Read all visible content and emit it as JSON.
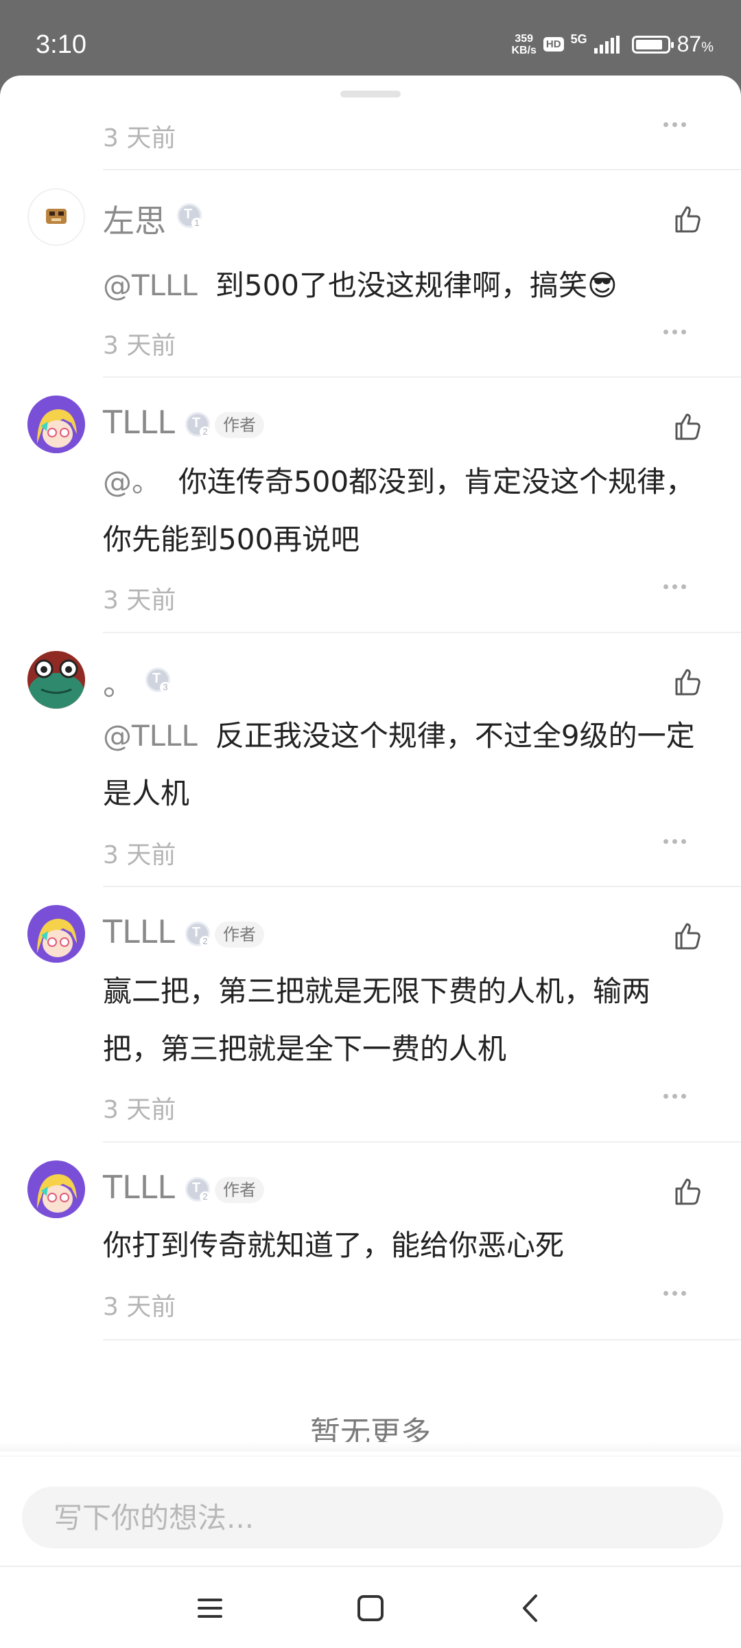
{
  "status_bar": {
    "time": "3:10",
    "net_speed_value": "359",
    "net_speed_unit": "KB/s",
    "hd": "HD",
    "network": "5G",
    "battery_level": 0.87,
    "battery_pct": "87",
    "battery_unit": "%"
  },
  "comments": [
    {
      "time": "3 天前"
    },
    {
      "user": "左思",
      "level": "1",
      "mention": "@TLLL",
      "text": "到500了也没这规律啊，搞笑😎",
      "time": "3 天前"
    },
    {
      "user": "TLLL",
      "level": "2",
      "author_tag": "作者",
      "mention": "@。",
      "text": "你连传奇500都没到，肯定没这个规律，你先能到500再说吧",
      "time": "3 天前"
    },
    {
      "user": "。",
      "level": "3",
      "mention": "@TLLL",
      "text": "反正我没这个规律，不过全9级的一定是人机",
      "time": "3 天前"
    },
    {
      "user": "TLLL",
      "level": "2",
      "author_tag": "作者",
      "text": "赢二把，第三把就是无限下费的人机，输两把，第三把就是全下一费的人机",
      "time": "3 天前"
    },
    {
      "user": "TLLL",
      "level": "2",
      "author_tag": "作者",
      "text": "你打到传奇就知道了，能给你恶心死",
      "time": "3 天前"
    }
  ],
  "level_badge_letter": "T",
  "no_more_text": "暂无更多",
  "comment_input": {
    "placeholder": "写下你的想法..."
  },
  "icons": {
    "like": "thumbs-up-icon",
    "more": "more-dots-icon",
    "menu": "menu-icon",
    "home": "home-square-icon",
    "back": "back-chevron-icon"
  },
  "colors": {
    "status_bar_bg": "#6b6b6b",
    "meta_text": "#b4b4b4",
    "username": "#8a8a8a",
    "body_text": "#222222"
  }
}
